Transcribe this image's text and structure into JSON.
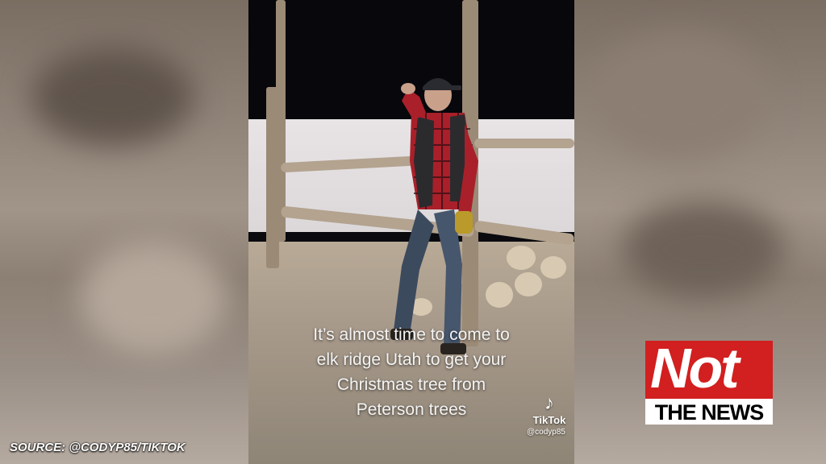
{
  "video": {
    "caption_lines": [
      "It’s almost time to come to",
      "elk ridge Utah to get your",
      "Christmas tree from",
      "Peterson trees"
    ]
  },
  "watermark": {
    "icon": "tiktok-note-icon",
    "name": "TikTok",
    "handle": "@codyp85"
  },
  "source": {
    "text": "SOURCE: @CODYP85/TIKTOK"
  },
  "logo": {
    "top_text": "Not",
    "bottom_text": "THE NEWS",
    "colors": {
      "red": "#d21f1f",
      "white": "#ffffff",
      "black": "#000000"
    }
  }
}
